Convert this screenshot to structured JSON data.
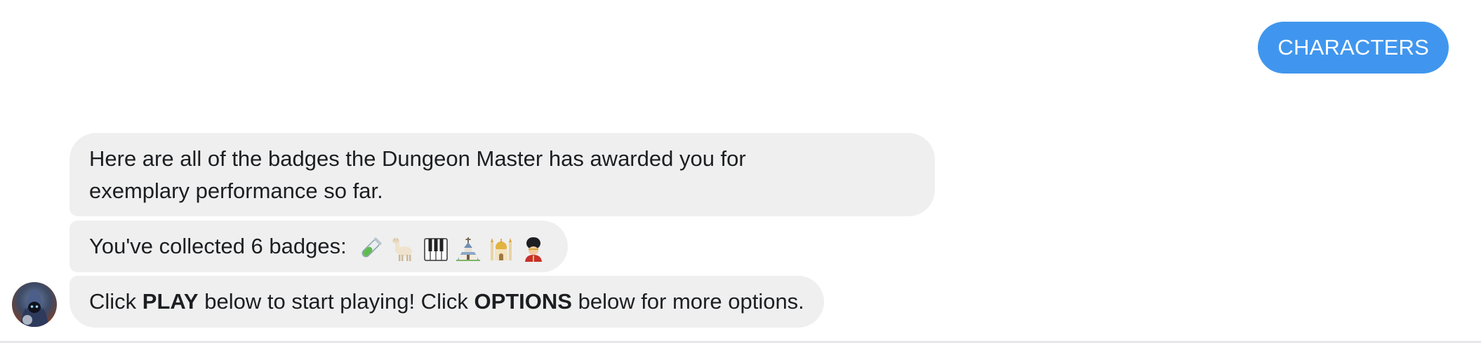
{
  "user_message": {
    "text": "CHARACTERS",
    "color": "#4096ee"
  },
  "bot_messages": [
    {
      "lines": [
        "Here are all of the badges the Dungeon Master has awarded you for",
        "exemplary performance so far."
      ]
    },
    {
      "text": "You've collected 6 badges:",
      "badges": [
        "test-tube-icon",
        "llama-icon",
        "piano-keys-icon",
        "church-icon",
        "mosque-icon",
        "guard-icon"
      ]
    },
    {
      "segments": {
        "s1": "Click ",
        "s2": "PLAY",
        "s3": " below to start playing! Click ",
        "s4": "OPTIONS",
        "s5": " below for more options."
      }
    }
  ],
  "bot_avatar": {
    "icon": "dungeon-master-avatar"
  }
}
